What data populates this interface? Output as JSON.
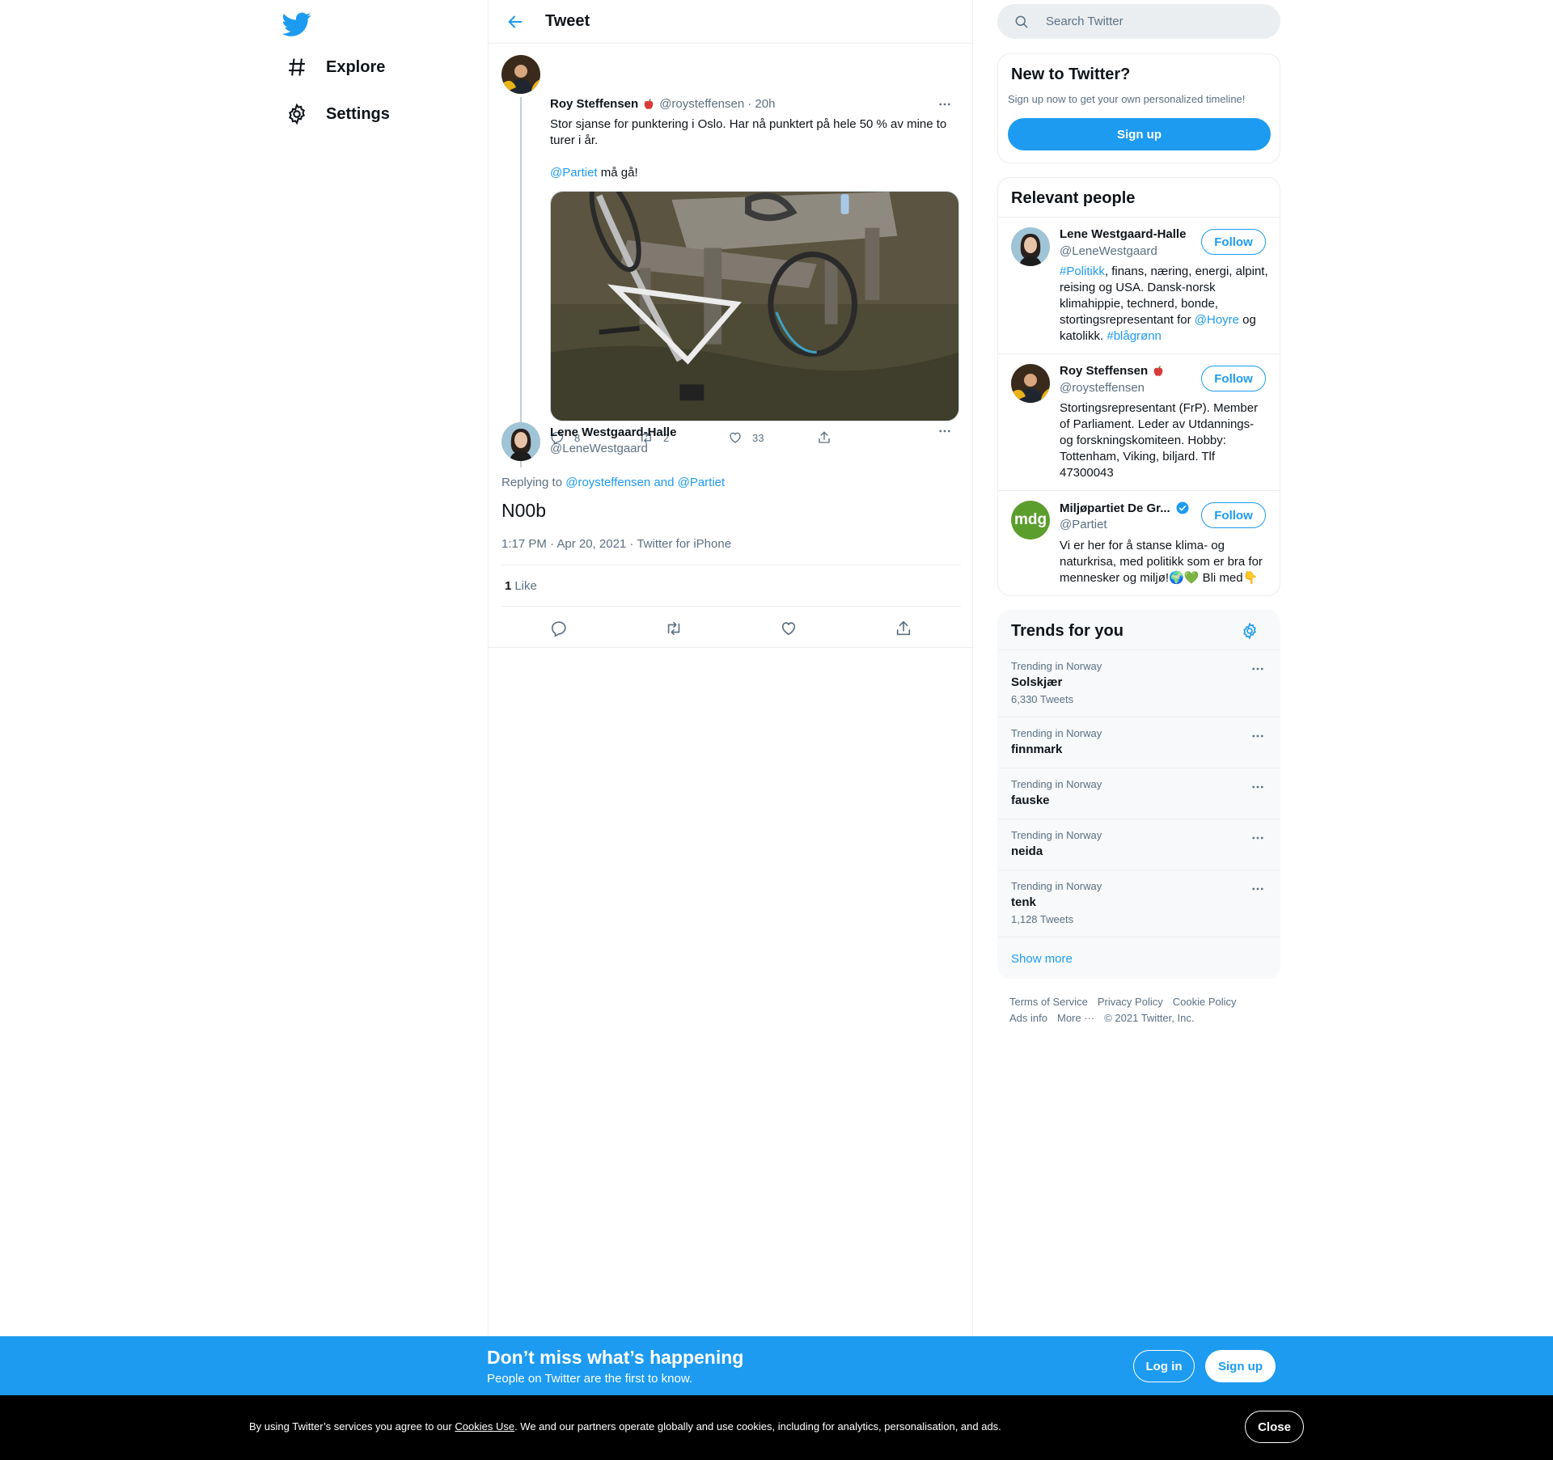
{
  "nav": {
    "explore_label": "Explore",
    "settings_label": "Settings"
  },
  "header": {
    "title": "Tweet"
  },
  "parent_tweet": {
    "name": "Roy Steffensen",
    "handle": "@roysteffensen",
    "time": "· 20h",
    "text_line1": "Stor sjanse for punktering i Oslo. Har nå punktert på hele 50 % av mine to turer i år.",
    "mention": "@Partiet",
    "text_line2": " må gå!",
    "replies": "8",
    "retweets": "2",
    "likes": "33"
  },
  "focused_tweet": {
    "name": "Lene Westgaard-Halle",
    "handle": "@LeneWestgaard",
    "replying_prefix": "Replying to ",
    "replying_to": "@roysteffensen and @Partiet",
    "body": "N00b",
    "meta": "1:17 PM · Apr 20, 2021 · Twitter for iPhone",
    "like_count": "1",
    "like_label": "Like"
  },
  "search": {
    "placeholder": "Search Twitter"
  },
  "new_to_twitter": {
    "title": "New to Twitter?",
    "subtitle": "Sign up now to get your own personalized timeline!",
    "button": "Sign up"
  },
  "relevant_people": {
    "title": "Relevant people",
    "follow_label": "Follow",
    "people": [
      {
        "name": "Lene Westgaard-Halle",
        "handle": "@LeneWestgaard",
        "bio_parts": [
          "#Politikk",
          ", finans, næring, energi, alpint, reising og USA. Dansk-norsk klimahippie, technerd, bonde, stortingsrepresentant for ",
          "@Hoyre",
          " og katolikk. ",
          "#blågrønn"
        ]
      },
      {
        "name": "Roy Steffensen",
        "handle": "@roysteffensen",
        "bio": "Stortingsrepresentant (FrP). Member of Parliament. Leder av Utdannings- og forskningskomiteen. Hobby: Tottenham, Viking, biljard. Tlf 47300043"
      },
      {
        "name": "Miljøpartiet De Gr...",
        "handle": "@Partiet",
        "avatar_text": "mdg",
        "bio": "Vi er her for å stanse klima- og naturkrisa, med politikk som er bra for mennesker og miljø!🌍💚 Bli med👇"
      }
    ]
  },
  "trends": {
    "title": "Trends for you",
    "show_more": "Show more",
    "items": [
      {
        "context": "Trending in Norway",
        "name": "Solskjær",
        "count": "6,330 Tweets"
      },
      {
        "context": "Trending in Norway",
        "name": "finnmark",
        "count": ""
      },
      {
        "context": "Trending in Norway",
        "name": "fauske",
        "count": ""
      },
      {
        "context": "Trending in Norway",
        "name": "neida",
        "count": ""
      },
      {
        "context": "Trending in Norway",
        "name": "tenk",
        "count": "1,128 Tweets"
      }
    ]
  },
  "footer": {
    "terms": "Terms of Service",
    "privacy": "Privacy Policy",
    "cookie": "Cookie Policy",
    "ads": "Ads info",
    "more": "More ···",
    "copyright": "© 2021 Twitter, Inc."
  },
  "banner": {
    "title": "Don’t miss what’s happening",
    "subtitle": "People on Twitter are the first to know.",
    "login": "Log in",
    "signup": "Sign up"
  },
  "cookie_bar": {
    "text_before": "By using Twitter’s services you agree to our ",
    "link": "Cookies Use",
    "text_after": ". We and our partners operate globally and use cookies, including for analytics, personalisation, and ads.",
    "close": "Close"
  },
  "colors": {
    "accent": "#1d9bf0",
    "muted": "#5b7083",
    "border": "#ebeef0",
    "cookie_bg": "#000000",
    "mdg_green": "#5b9e2d"
  }
}
